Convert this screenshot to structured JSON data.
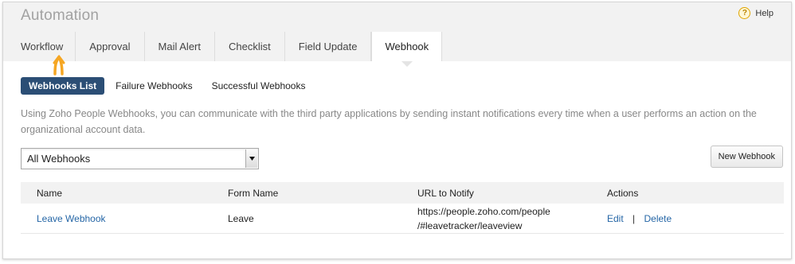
{
  "header": {
    "title": "Automation",
    "help_label": "Help",
    "help_icon": "question-circle-icon"
  },
  "tabs": [
    {
      "label": "Workflow"
    },
    {
      "label": "Approval"
    },
    {
      "label": "Mail Alert"
    },
    {
      "label": "Checklist"
    },
    {
      "label": "Field Update"
    },
    {
      "label": "Webhook",
      "active": true
    }
  ],
  "subtabs": [
    {
      "label": "Webhooks List",
      "active": true
    },
    {
      "label": "Failure Webhooks"
    },
    {
      "label": "Successful Webhooks"
    }
  ],
  "description": "Using Zoho People Webhooks, you can communicate with the third party applications by sending instant notifications every time when a user performs an action on the organizational account data.",
  "filter": {
    "selected": "All Webhooks"
  },
  "new_button_label": "New Webhook",
  "table": {
    "columns": [
      "Name",
      "Form Name",
      "URL to Notify",
      "Actions"
    ],
    "rows": [
      {
        "name": "Leave Webhook",
        "form": "Leave",
        "url_line1": "https://people.zoho.com/people",
        "url_line2": "/#leavetracker/leaveview",
        "edit": "Edit",
        "separator": "|",
        "delete": "Delete"
      }
    ]
  },
  "colors": {
    "accent": "#2b4e75",
    "link": "#2566a6",
    "pointer": "#f5a623"
  }
}
